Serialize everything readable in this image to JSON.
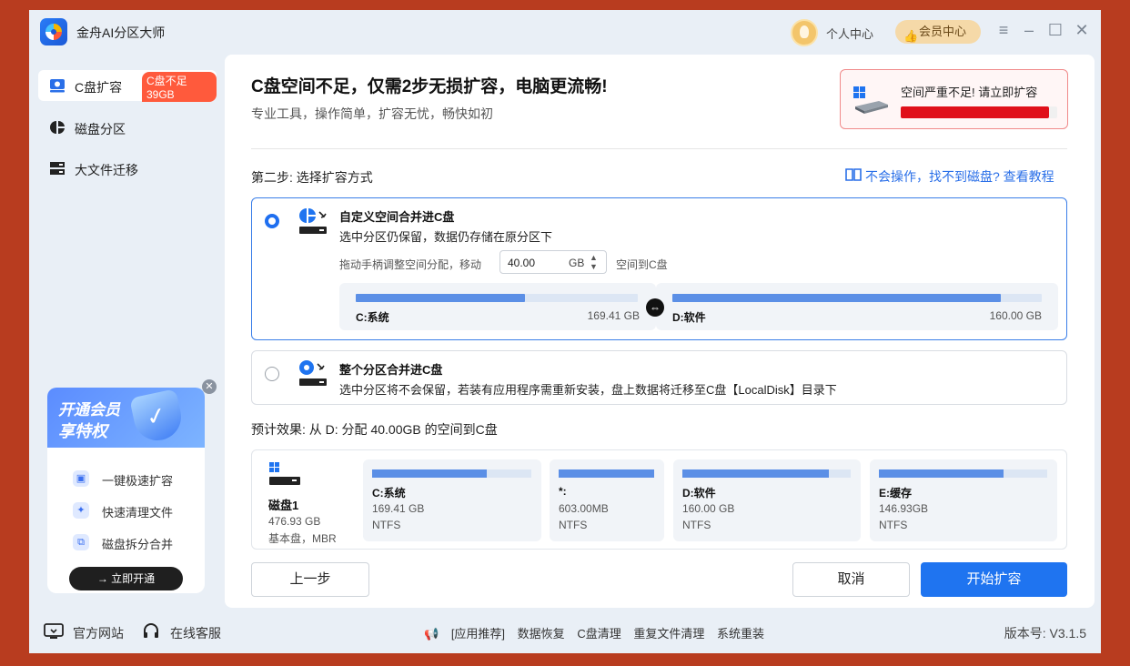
{
  "app": {
    "title": "金舟AI分区大师"
  },
  "header": {
    "user_center": "个人中心",
    "vip_center": "会员中心"
  },
  "sidebar": {
    "items": [
      {
        "label": "C盘扩容",
        "badge": "C盘不足39GB"
      },
      {
        "label": "磁盘分区"
      },
      {
        "label": "大文件迁移"
      }
    ]
  },
  "vip_card": {
    "title_line1": "开通会员",
    "title_line2": "享特权",
    "features": [
      "一键极速扩容",
      "快速清理文件",
      "磁盘拆分合并"
    ],
    "open_button": "→ 立即开通"
  },
  "main": {
    "headline": "C盘空间不足，仅需2步无损扩容，电脑更流畅!",
    "subtitle": "专业工具，操作简单，扩容无忧，畅快如初",
    "alert": {
      "text": "空间严重不足! 请立即扩容",
      "fill": 0.95,
      "color": "#e0101a"
    },
    "step_label": "第二步: 选择扩容方式",
    "help_link": "不会操作，找不到磁盘? 查看教程",
    "option1": {
      "title": "自定义空间合并进C盘",
      "desc": "选中分区仍保留，数据仍存储在原分区下",
      "adjust_label": "拖动手柄调整空间分配，移动",
      "adjust_value": "40.00",
      "adjust_unit": "GB",
      "adjust_tail": "空间到C盘",
      "left_part": {
        "name": "C:系统",
        "size": "169.41 GB",
        "fill": 0.6
      },
      "right_part": {
        "name": "D:软件",
        "size": "160.00 GB",
        "fill": 0.89
      }
    },
    "option2": {
      "title": "整个分区合并进C盘",
      "desc": "选中分区将不会保留，若装有应用程序需重新安装，盘上数据将迁移至C盘【LocalDisk】目录下"
    },
    "preview_title": "预计效果: 从 D: 分配 40.00GB 的空间到C盘",
    "disk": {
      "name": "磁盘1",
      "size": "476.93 GB",
      "type": "基本盘，MBR"
    },
    "volumes": [
      {
        "name": "C:系统",
        "size": "169.41 GB",
        "fs": "NTFS",
        "fill": 0.72
      },
      {
        "name": "*:",
        "size": "603.00MB",
        "fs": "NTFS",
        "fill": 1.0
      },
      {
        "name": "D:软件",
        "size": "160.00 GB",
        "fs": "NTFS",
        "fill": 0.87
      },
      {
        "name": "E:缓存",
        "size": "146.93GB",
        "fs": "NTFS",
        "fill": 0.74
      }
    ],
    "buttons": {
      "prev": "上一步",
      "cancel": "取消",
      "start": "开始扩容"
    }
  },
  "footer": {
    "website": "官方网站",
    "support": "在线客服",
    "recommend_label": "[应用推荐]",
    "recommend_items": [
      "数据恢复",
      "C盘清理",
      "重复文件清理",
      "系统重装"
    ],
    "version": "版本号: V3.1.5"
  }
}
